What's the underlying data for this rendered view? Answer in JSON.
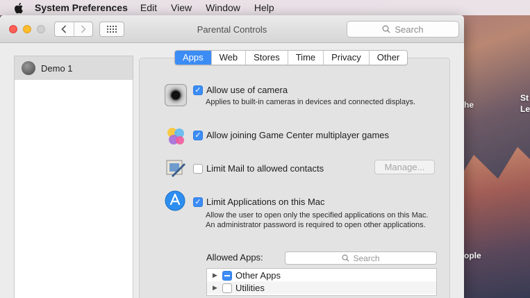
{
  "menubar": {
    "app": "System Preferences",
    "items": [
      "Edit",
      "View",
      "Window",
      "Help"
    ]
  },
  "window": {
    "title": "Parental Controls",
    "search_placeholder": "Search"
  },
  "sidebar": {
    "users": [
      {
        "name": "Demo 1"
      }
    ]
  },
  "tabs": [
    {
      "label": "Apps",
      "active": true
    },
    {
      "label": "Web"
    },
    {
      "label": "Stores"
    },
    {
      "label": "Time"
    },
    {
      "label": "Privacy"
    },
    {
      "label": "Other"
    }
  ],
  "apps_pane": {
    "camera": {
      "label": "Allow use of camera",
      "checked": true,
      "desc": "Applies to built-in cameras in devices and connected displays."
    },
    "game_center": {
      "label": "Allow joining Game Center multiplayer games",
      "checked": true
    },
    "mail": {
      "label": "Limit Mail to allowed contacts",
      "checked": false,
      "button": "Manage..."
    },
    "limit_apps": {
      "label": "Limit Applications on this Mac",
      "checked": true,
      "desc": "Allow the user to open only the specified applications on this Mac. An administrator password is required to open other applications."
    },
    "allowed_apps_label": "Allowed Apps:",
    "allowed_search_placeholder": "Search",
    "tree": [
      {
        "label": "Other Apps",
        "state": "mixed"
      },
      {
        "label": "Utilities",
        "state": "unchecked"
      }
    ]
  },
  "desktop": {
    "text_1": "St",
    "text_2": "Le",
    "text_3": "he",
    "text_4": "ople"
  },
  "colors": {
    "accent": "#3c8cf5"
  }
}
